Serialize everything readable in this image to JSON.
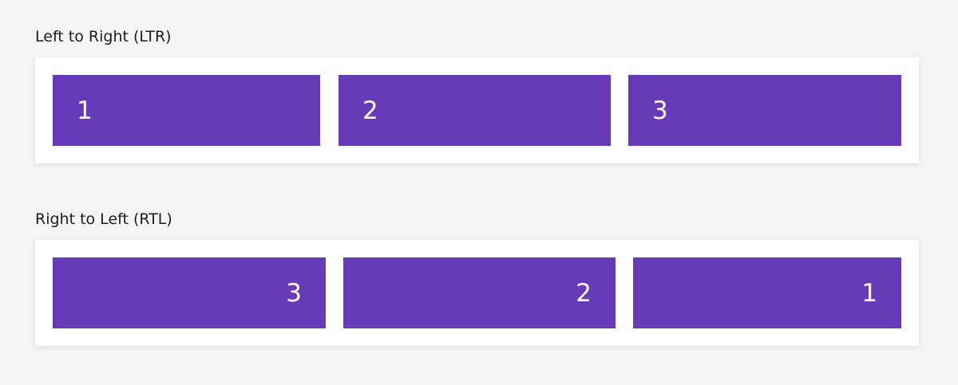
{
  "sections": [
    {
      "label": "Left to Right (LTR)",
      "items": [
        "1",
        "2",
        "3"
      ]
    },
    {
      "label": "Right to Left (RTL)",
      "items": [
        "1",
        "2",
        "3"
      ]
    }
  ],
  "colors": {
    "background": "#f5f5f5",
    "panel": "#ffffff",
    "item": "#673ab7",
    "item_text": "#ffffff"
  }
}
